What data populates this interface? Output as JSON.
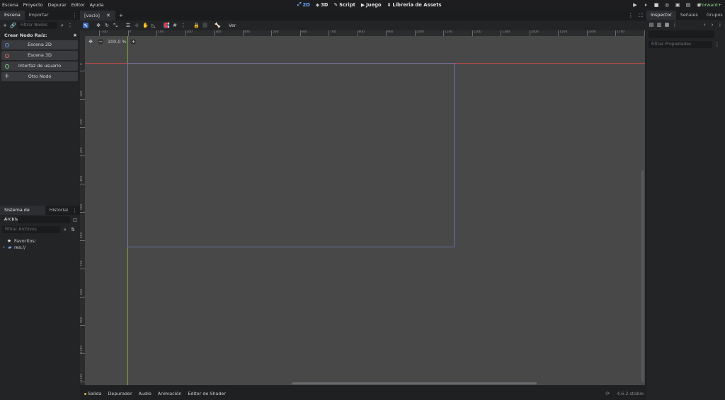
{
  "menu": [
    "Escena",
    "Proyecto",
    "Depurar",
    "Editor",
    "Ayuda"
  ],
  "workspaces": [
    {
      "label": "2D",
      "icon": "2d-icon",
      "glyph": "⤢",
      "active": true
    },
    {
      "label": "3D",
      "icon": "3d-icon",
      "glyph": "◈",
      "active": false
    },
    {
      "label": "Script",
      "icon": "script-icon",
      "glyph": "✎",
      "active": false
    },
    {
      "label": "Juego",
      "icon": "game-icon",
      "glyph": "▶",
      "active": false
    },
    {
      "label": "Libreria de Assets",
      "icon": "asset-library-icon",
      "glyph": "⬇",
      "active": false
    }
  ],
  "renderer": "Forward+",
  "left_dock": {
    "tabs": [
      "Escena",
      "Importar"
    ],
    "filter_placeholder": "Filtrar Nodos",
    "create_root_label": "Crear Nodo Raíz:",
    "nodes": [
      {
        "label": "Escena 2D",
        "color": "#5c8ee8"
      },
      {
        "label": "Escena 3D",
        "color": "#f06a6a"
      },
      {
        "label": "Interfaz de usuario",
        "color": "#7bd37a"
      },
      {
        "label": "Otro Nodo",
        "color": "#cccccc"
      }
    ],
    "fs_tabs": [
      "Sistema de Archivos",
      "Historial"
    ],
    "fs_filter_placeholder": "Filtrar Archivos",
    "favorites_label": "Favoritos:",
    "res_label": "res://"
  },
  "scene_tab": "[vacío]",
  "toolbar": {
    "view_label": "Ver"
  },
  "zoom_label": "100,0 %",
  "ruler_top": [
    "-100",
    "0",
    "100",
    "200",
    "300",
    "400",
    "500",
    "600",
    "700",
    "800",
    "900",
    "1000",
    "1100",
    "1200",
    "1300",
    "1400",
    "1500",
    "1600",
    "1700",
    "1800"
  ],
  "ruler_left": [
    "0",
    "100",
    "200",
    "300",
    "400",
    "500",
    "600",
    "700",
    "800",
    "900",
    "1000",
    "1100"
  ],
  "bottom_panels": [
    "Salida",
    "Depurador",
    "Audio",
    "Animación",
    "Editor de Shader"
  ],
  "version": "4.6.2.stable",
  "right_dock": {
    "tabs": [
      "Inspector",
      "Señales",
      "Grupos"
    ],
    "filter_placeholder": "Filtrar Propiedades"
  }
}
